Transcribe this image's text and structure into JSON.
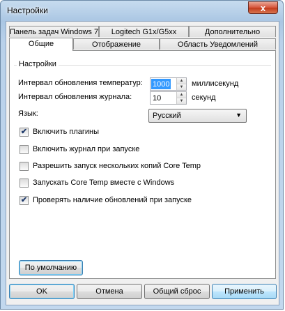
{
  "window": {
    "title": "Настройки",
    "close_glyph": "x"
  },
  "tabs_row1": [
    {
      "label": "Панель задач Windows 7"
    },
    {
      "label": "Logitech G1x/G5xx"
    },
    {
      "label": "Дополнительно"
    }
  ],
  "tabs_row2": [
    {
      "label": "Общие",
      "active": true
    },
    {
      "label": "Отображение"
    },
    {
      "label": "Область Уведомлений"
    }
  ],
  "settings": {
    "group_label": "Настройки",
    "temp_interval": {
      "label": "Интервал обновления температур:",
      "value": "1000",
      "unit": "миллисекунд"
    },
    "log_interval": {
      "label": "Интервал обновления журнала:",
      "value": "10",
      "unit": "секунд"
    },
    "language": {
      "label": "Язык:",
      "value": "Русский"
    },
    "spin_up_glyph": "▲",
    "spin_down_glyph": "▼",
    "dropdown_glyph": "▼",
    "check_glyph": "✔"
  },
  "checkboxes": [
    {
      "label": "Включить плагины",
      "checked": true
    },
    {
      "label": "Включить журнал при запуске",
      "checked": false
    },
    {
      "label": "Разрешить запуск нескольких копий Core Temp",
      "checked": false
    },
    {
      "label": "Запускать Core Temp вместе с Windows",
      "checked": false
    },
    {
      "label": "Проверять наличие обновлений при запуске",
      "checked": true
    }
  ],
  "buttons": {
    "defaults": "По умолчанию",
    "ok": "OK",
    "cancel": "Отмена",
    "reset": "Общий сброс",
    "apply": "Применить"
  }
}
